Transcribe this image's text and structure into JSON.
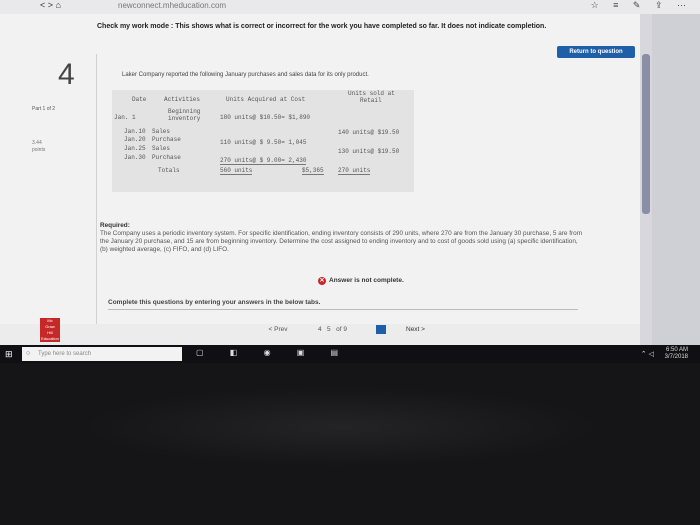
{
  "browser": {
    "url": "newconnect.mheducation.com",
    "nav": "<  >  ⌂",
    "icons": "☆ ≡ ✎ ⇪ ⋯"
  },
  "notice": "Check my work mode : This shows what is correct or incorrect for the work you have completed so far. It does not indicate completion.",
  "return_button": "Return to question",
  "question_number": "4",
  "part_label": "Part 1 of 2",
  "points": [
    "3.44",
    "points"
  ],
  "prompt": "Laker Company reported the following January purchases and sales data for its only product.",
  "table": {
    "headers": {
      "date": "Date",
      "activities": "Activities",
      "units_acquired": "Units Acquired at Cost",
      "units_sold": "Units sold at",
      "retail": "Retail"
    },
    "rows": [
      {
        "date": "Jan. 1",
        "activity": "Beginning\ninventory",
        "acquired": "180 units@ $10.50= $1,890",
        "sold": ""
      },
      {
        "date": "Jan.10",
        "activity": "Sales",
        "acquired": "",
        "sold": "140 units@ $19.50"
      },
      {
        "date": "Jan.20",
        "activity": "Purchase",
        "acquired": "110 units@ $ 9.50= 1,045",
        "sold": ""
      },
      {
        "date": "Jan.25",
        "activity": "Sales",
        "acquired": "",
        "sold": "130 units@ $19.50"
      },
      {
        "date": "Jan.30",
        "activity": "Purchase",
        "acquired": "270 units@ $ 9.00= 2,430",
        "sold": ""
      }
    ],
    "totals": {
      "label": "Totals",
      "units": "560 units",
      "cost": "$5,365",
      "sold": "270 units"
    }
  },
  "required": {
    "label": "Required:",
    "text": "The Company uses a periodic inventory system. For specific identification, ending inventory consists of 290 units, where 270 are from the January 30 purchase, 5 are from the January 20 purchase, and 15 are from beginning inventory. Determine the cost assigned to ending inventory and to cost of goods sold using (a) specific identification, (b) weighted average, (c) FIFO, and (d) LIFO."
  },
  "answer_status": "Answer is not complete.",
  "complete_instruction": "Complete this questions by entering your answers in the below tabs.",
  "footer": {
    "prev": "Prev",
    "page_current": "4",
    "page_next": "5",
    "page_total": "of 9",
    "next": "Next"
  },
  "logo": "Mc\nGraw\nHill\nEducation",
  "taskbar": {
    "search_placeholder": "Type here to search",
    "time": "6:50 AM",
    "date": "3/7/2018"
  }
}
